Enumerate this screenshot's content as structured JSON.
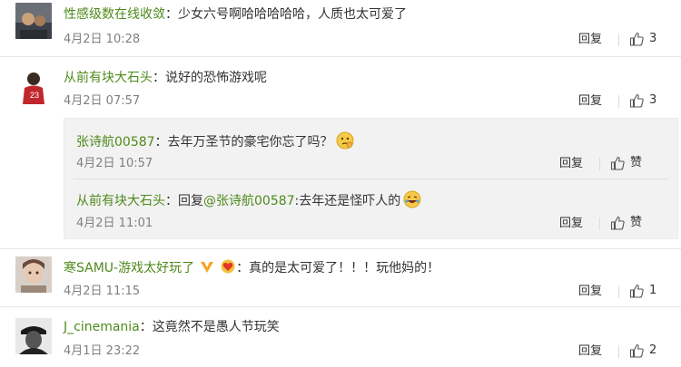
{
  "comments": [
    {
      "username": "性感级数在线收敛",
      "text": "少女六号啊哈哈哈哈哈，人质也太可爱了",
      "time": "4月2日 10:28",
      "reply_label": "回复",
      "likes": "3"
    },
    {
      "username": "从前有块大石头",
      "text": "说好的恐怖游戏呢",
      "time": "4月2日 07:57",
      "reply_label": "回复",
      "likes": "3",
      "replies": [
        {
          "username": "张诗航00587",
          "text": "去年万圣节的豪宅你忘了吗？",
          "time": "4月2日 10:57",
          "reply_label": "回复",
          "like_label": "赞"
        },
        {
          "username": "从前有块大石头",
          "reply_prefix": "回复",
          "mention": "@张诗航00587",
          "text": ":去年还是怪吓人的",
          "time": "4月2日 11:01",
          "reply_label": "回复",
          "like_label": "赞"
        }
      ]
    },
    {
      "username": "寒SAMU-游戏太好玩了",
      "text": "：真的是太可爱了！！！玩他妈的！",
      "time": "4月2日 11:15",
      "reply_label": "回复",
      "likes": "1"
    },
    {
      "username": "J_cinemania",
      "text": "这竟然不是愚人节玩笑",
      "time": "4月1日 23:22",
      "reply_label": "回复",
      "likes": "2"
    }
  ],
  "colors": {
    "username": "#4e8a1b",
    "text": "#333333",
    "time": "#808080",
    "reply_bg": "#f2f2f2"
  },
  "icons": [
    "thumb-up-icon",
    "thinking-emoji-icon",
    "laughing-emoji-icon",
    "heart-badge-icon",
    "v-badge-icon"
  ]
}
